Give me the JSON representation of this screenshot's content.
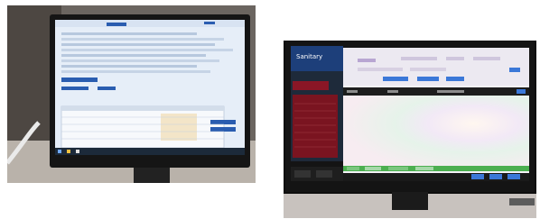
{
  "photos": [
    {
      "id": "left",
      "screen_bg": "#e8f0f8",
      "frame": "#1a1a1a",
      "ui_accent": "#2a5db0",
      "taskbar": "#1c2a3a"
    },
    {
      "id": "right",
      "brand_text": "Sanitary",
      "screen_bg": "#f4f2f7",
      "frame": "#141414",
      "sidebar_bg": "#7a1420",
      "header_bar": "#1d1d1d",
      "ui_accent": "#3b78d8",
      "status_green": "#4caf50"
    }
  ]
}
